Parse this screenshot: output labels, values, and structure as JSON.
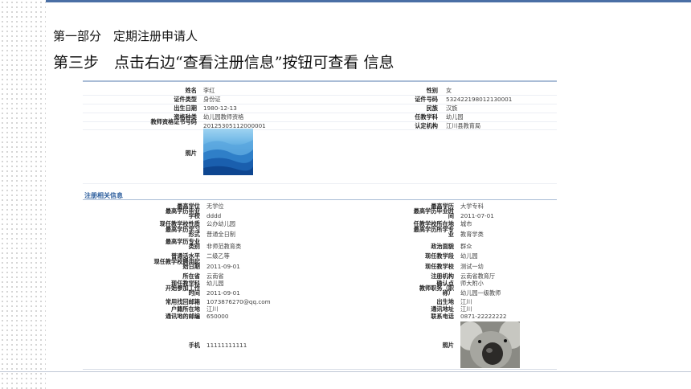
{
  "slide": {
    "heading1": "第一部分　定期注册申请人",
    "heading2": "第三步　点击右边“查看注册信息”按钮可查看 信息"
  },
  "form": {
    "basic": [
      {
        "label": "姓名",
        "value": "李红",
        "label2": "性别",
        "value2": "女"
      },
      {
        "label": "证件类型",
        "value": "身份证",
        "label2": "证件号码",
        "value2": "532422198012130001"
      },
      {
        "label": "出生日期",
        "value": "1980-12-13",
        "label2": "民族",
        "value2": "汉族"
      },
      {
        "label": "资格种类",
        "value": "幼儿园教师资格",
        "label2": "任教学科",
        "value2": "幼儿园"
      },
      {
        "label": "教师资格证书号码",
        "value": "20125305112000001",
        "label2": "认定机构",
        "value2": "江川县教育局"
      }
    ],
    "photo_label": "照片",
    "section_title": "注册相关信息",
    "detail": [
      {
        "label": "最高学位",
        "value": "无学位",
        "label2": "最高学历",
        "value2": "大学专科"
      },
      {
        "label": "最高学历毕业学校",
        "value": "dddd",
        "label2": "最高学历毕业时间",
        "value2": "2011-07-01"
      },
      {
        "label": "现任教学校性质",
        "value": "公办幼儿园",
        "label2": "任教学校所在地",
        "value2": "城市"
      },
      {
        "label": "最高学历学习形式",
        "value": "普通全日制",
        "label2": "最高学历所学专业",
        "value2": "教育学类"
      },
      {
        "label": "最高学历专业类别",
        "value": "非师范教育类",
        "label2": "政治面貌",
        "value2": "群众"
      },
      {
        "label": "普通话水平",
        "value": "二级乙等",
        "label2": "现任教学段",
        "value2": "幼儿园"
      },
      {
        "label": "现任教学校聘用起始日期",
        "value": "2011-09-01",
        "label2": "现任教学校",
        "value2": "测试一幼"
      },
      {
        "label": "所在省",
        "value": "云南省",
        "label2": "注册机构",
        "value2": "云南省教育厅"
      },
      {
        "label": "现任教学科",
        "value": "幼儿园",
        "label2": "确认点",
        "value2": "师大附小"
      },
      {
        "label": "开始参加工作时间",
        "value": "2011-09-01",
        "label2": "教师职务（职称）",
        "value2": "幼儿园一级教师"
      },
      {
        "label": "常用找回邮箱",
        "value": "1073876270@qq.com",
        "label2": "出生地",
        "value2": "江川"
      },
      {
        "label": "户籍所在地",
        "value": "江川",
        "label2": "通讯地址",
        "value2": "江川"
      },
      {
        "label": "通讯地的邮编",
        "value": "650000",
        "label2": "联系电话",
        "value2": "0871-22222222"
      }
    ],
    "phone_label": "手机",
    "phone_value": "11111111111",
    "photo_label2": "照片"
  }
}
